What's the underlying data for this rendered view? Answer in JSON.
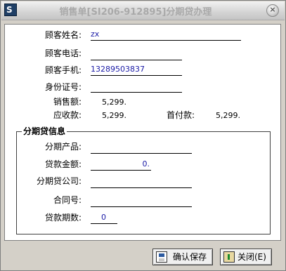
{
  "window": {
    "title": "销售单[SI206-912895]分期贷办理",
    "app_icon_glyph": "S",
    "close_glyph": "×"
  },
  "customer": {
    "name_label": "顾客姓名:",
    "name_value": "zx",
    "phone_label": "顾客电话:",
    "phone_value": "",
    "mobile_label": "顾客手机:",
    "mobile_value": "13289503837",
    "id_label": "身份证号:",
    "id_value": ""
  },
  "amounts": {
    "sales_label": "销售额:",
    "sales_value": "5,299.",
    "receivable_label": "应收款:",
    "receivable_value": "5,299.",
    "down_label": "首付款:",
    "down_value": "5,299."
  },
  "installment": {
    "group_title": "分期贷信息",
    "product_label": "分期产品:",
    "product_value": "",
    "loan_label": "贷款金额:",
    "loan_value": "0.",
    "company_label": "分期贷公司:",
    "company_value": "",
    "contract_label": "合同号:",
    "contract_value": "",
    "periods_label": "贷款期数:",
    "periods_value": "0"
  },
  "buttons": {
    "save_label": "确认保存",
    "close_label": "关闭(E)"
  },
  "colors": {
    "field_text": "#1a1aa6",
    "title_text": "#a9a9a9",
    "window_bg": "#d4d0c8"
  },
  "icons": [
    "app-logo-icon",
    "close-icon",
    "save-icon",
    "exit-icon"
  ]
}
